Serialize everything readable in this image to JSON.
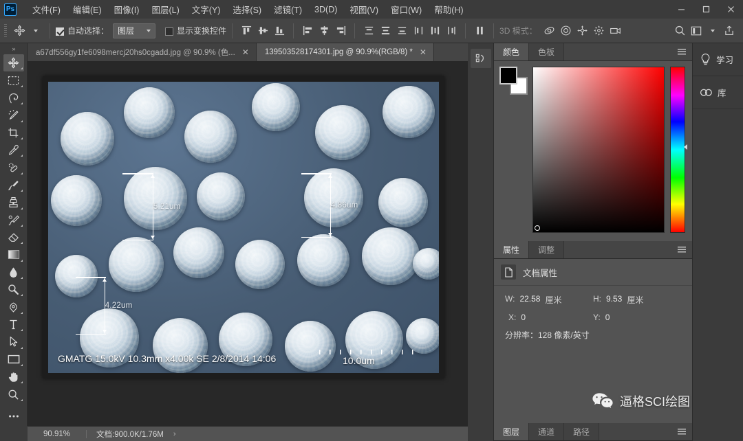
{
  "app": {
    "logo_text": "Ps",
    "window_controls": [
      {
        "name": "minimize",
        "glyph": "–"
      },
      {
        "name": "maximize",
        "glyph": "☐"
      },
      {
        "name": "close",
        "glyph": "✕"
      }
    ]
  },
  "menubar": {
    "items": [
      {
        "label": "文件(F)"
      },
      {
        "label": "编辑(E)"
      },
      {
        "label": "图像(I)"
      },
      {
        "label": "图层(L)"
      },
      {
        "label": "文字(Y)"
      },
      {
        "label": "选择(S)"
      },
      {
        "label": "滤镜(T)"
      },
      {
        "label": "3D(D)"
      },
      {
        "label": "视图(V)"
      },
      {
        "label": "窗口(W)"
      },
      {
        "label": "帮助(H)"
      }
    ]
  },
  "options_bar": {
    "auto_select_label": "自动选择：",
    "auto_select_checked": true,
    "auto_select_value": "图层",
    "show_transform_label": "显示变换控件",
    "show_transform_checked": false,
    "mode3d_label": "3D 模式：",
    "align_icons": [
      "align-top-edges-icon",
      "align-vertical-centers-icon",
      "align-bottom-edges-icon",
      "align-left-edges-icon",
      "align-horizontal-centers-icon",
      "align-right-edges-icon"
    ],
    "distribute_icons": [
      "distribute-top-icon",
      "distribute-vertical-center-icon",
      "distribute-bottom-icon",
      "distribute-left-icon",
      "distribute-horizontal-center-icon",
      "distribute-right-icon",
      "distribute-spacing-icon"
    ],
    "mode3d_icons": [
      "orbit-3d-icon",
      "roll-3d-icon",
      "pan-3d-icon",
      "slide-3d-icon",
      "camera-3d-icon"
    ],
    "right_icons": [
      "search-icon",
      "workspace-icon",
      "chevron-down-icon",
      "share-icon"
    ]
  },
  "toolbar": {
    "collapse_label": "»",
    "tools": [
      {
        "name": "move-tool",
        "active": true
      },
      {
        "name": "marquee-tool",
        "active": false
      },
      {
        "name": "lasso-tool",
        "active": false
      },
      {
        "name": "magic-wand-tool",
        "active": false
      },
      {
        "name": "crop-tool",
        "active": false
      },
      {
        "name": "eyedropper-tool",
        "active": false
      },
      {
        "name": "healing-brush-tool",
        "active": false
      },
      {
        "name": "brush-tool",
        "active": false
      },
      {
        "name": "clone-stamp-tool",
        "active": false
      },
      {
        "name": "history-brush-tool",
        "active": false
      },
      {
        "name": "eraser-tool",
        "active": false
      },
      {
        "name": "gradient-tool",
        "active": false
      },
      {
        "name": "blur-tool",
        "active": false
      },
      {
        "name": "dodge-tool",
        "active": false
      },
      {
        "name": "pen-tool",
        "active": false
      },
      {
        "name": "type-tool",
        "active": false
      },
      {
        "name": "path-selection-tool",
        "active": false
      },
      {
        "name": "rectangle-tool",
        "active": false
      },
      {
        "name": "hand-tool",
        "active": false
      },
      {
        "name": "zoom-tool",
        "active": false
      },
      {
        "name": "edit-toolbar-tool",
        "active": false
      }
    ],
    "foreground_color": "#000000",
    "background_color": "#ffffff"
  },
  "document_tabs": [
    {
      "title": "a67df556gy1fe6098mercj20hs0cgadd.jpg @ 90.9% (色...",
      "active": false,
      "close_glyph": "✕"
    },
    {
      "title": "139503528174301.jpg @ 90.9%(RGB/8) *",
      "active": true,
      "close_glyph": "✕"
    }
  ],
  "canvas": {
    "image_caption": "GMATG 15.0kV 10.3mm x4.00k SE  2/8/2014 14:06",
    "scale_bar_value": "10.0um",
    "measurements": [
      {
        "label": "5.21um"
      },
      {
        "label": "4.86um"
      },
      {
        "label": "4.22um"
      }
    ]
  },
  "color_panel": {
    "tabs": [
      {
        "label": "颜色",
        "active": true
      },
      {
        "label": "色板",
        "active": false
      }
    ],
    "foreground_color": "#000000",
    "background_color": "#ffffff"
  },
  "properties_panel": {
    "tabs": [
      {
        "label": "属性",
        "active": true
      },
      {
        "label": "调整",
        "active": false
      }
    ],
    "title": "文档属性",
    "fields": [
      {
        "key": "W:",
        "value": "22.58",
        "unit": "厘米"
      },
      {
        "key": "H:",
        "value": "9.53",
        "unit": "厘米"
      },
      {
        "key": "X:",
        "value": "0",
        "unit": ""
      },
      {
        "key": "Y:",
        "value": "0",
        "unit": ""
      }
    ],
    "resolution": "分辨率：128 像素/英寸"
  },
  "layers_panel": {
    "tabs": [
      {
        "label": "图层",
        "active": true
      },
      {
        "label": "通道",
        "active": false
      },
      {
        "label": "路径",
        "active": false
      }
    ]
  },
  "far_right_sidebar": {
    "items": [
      {
        "label": "学习",
        "icon": "lightbulb-icon"
      },
      {
        "label": "库",
        "icon": "creative-cloud-icon"
      }
    ]
  },
  "watermark": {
    "text": "逼格SCI绘图",
    "icon": "wechat-icon"
  },
  "status_bar": {
    "zoom": "90.91%",
    "doc_info": "文档:900.0K/1.76M",
    "arrow": "›"
  },
  "colors": {
    "accent": "#31a8ff",
    "panel_bg": "#535353",
    "chrome_bg": "#3b3b3b",
    "canvas_bg": "#282828",
    "sem_bg": "#4c637b"
  }
}
